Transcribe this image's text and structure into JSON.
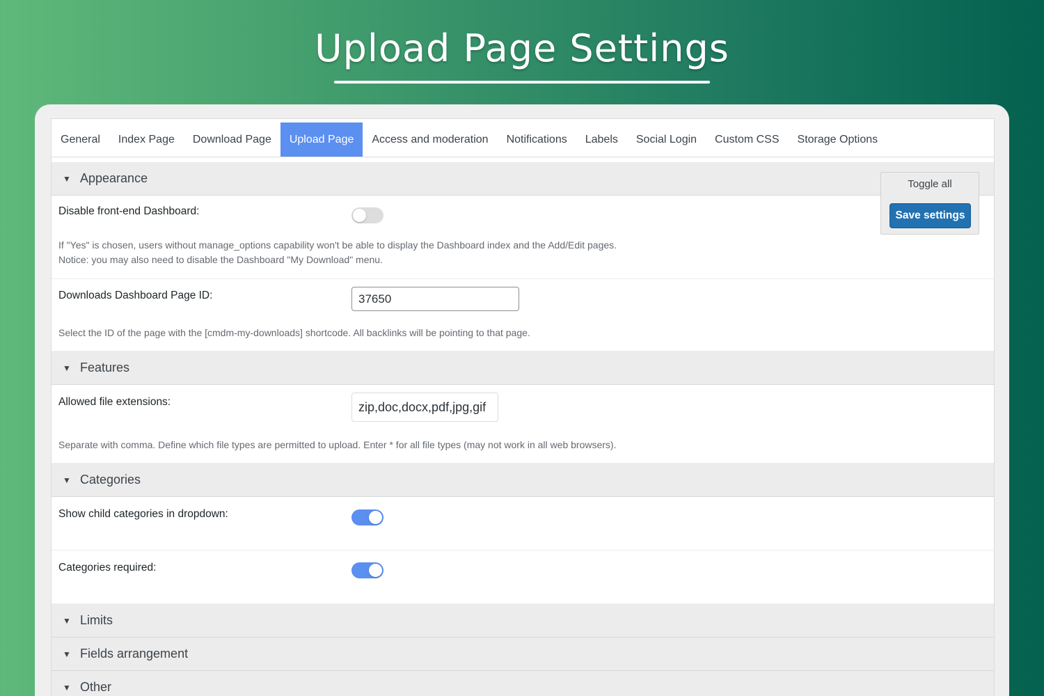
{
  "hero": {
    "title": "Upload Page Settings"
  },
  "tabs": [
    {
      "label": "General"
    },
    {
      "label": "Index Page"
    },
    {
      "label": "Download Page"
    },
    {
      "label": "Upload Page",
      "active": true
    },
    {
      "label": "Access and moderation"
    },
    {
      "label": "Notifications"
    },
    {
      "label": "Labels"
    },
    {
      "label": "Social Login"
    },
    {
      "label": "Custom CSS"
    },
    {
      "label": "Storage Options"
    }
  ],
  "actions": {
    "toggle_all": "Toggle all",
    "save": "Save settings"
  },
  "sections": {
    "appearance": {
      "title": "Appearance",
      "disable_dashboard": {
        "label": "Disable front-end Dashboard:",
        "enabled": false,
        "desc_line1": "If \"Yes\" is chosen, users without manage_options capability won't be able to display the Dashboard index and the Add/Edit pages.",
        "desc_line2": "Notice: you may also need to disable the Dashboard \"My Download\" menu."
      },
      "dashboard_page_id": {
        "label": "Downloads Dashboard Page ID:",
        "value": "37650",
        "desc": "Select the ID of the page with the [cmdm-my-downloads] shortcode. All backlinks will be pointing to that page."
      }
    },
    "features": {
      "title": "Features",
      "allowed_extensions": {
        "label": "Allowed file extensions:",
        "value": "zip,doc,docx,pdf,jpg,gif",
        "desc": "Separate with comma. Define which file types are permitted to upload. Enter * for all file types (may not work in all web browsers)."
      }
    },
    "categories": {
      "title": "Categories",
      "show_child": {
        "label": "Show child categories in dropdown:",
        "enabled": true
      },
      "required": {
        "label": "Categories required:",
        "enabled": true
      }
    },
    "limits": {
      "title": "Limits"
    },
    "fields_arrangement": {
      "title": "Fields arrangement"
    },
    "other": {
      "title": "Other"
    }
  },
  "colors": {
    "accent": "#5b8ff0",
    "save_button": "#2271b1",
    "section_bg": "#ececec"
  }
}
